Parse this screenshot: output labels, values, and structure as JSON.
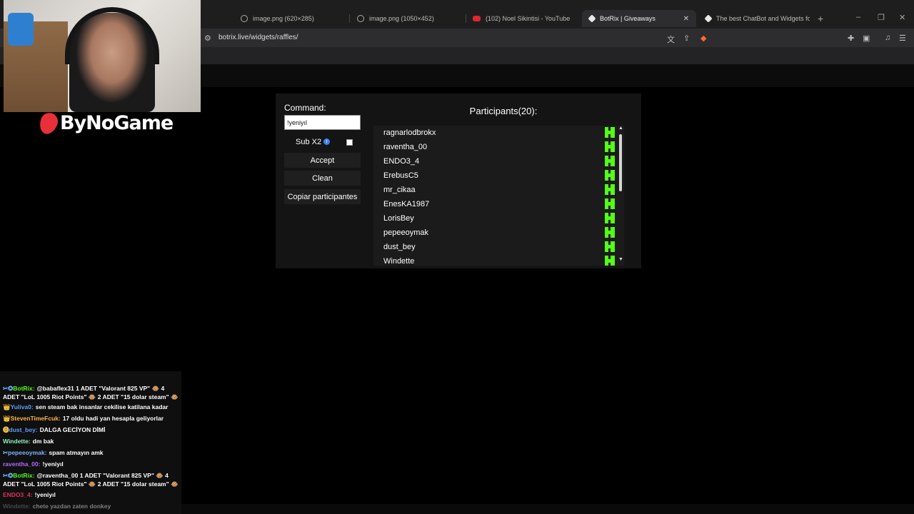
{
  "browser": {
    "tabs": [
      {
        "title": "image.png (620×285)",
        "active": false
      },
      {
        "title": "image.png (1050×452)",
        "active": false
      },
      {
        "title": "(102) Noel Sikintisi - YouTube",
        "active": false
      },
      {
        "title": "BotRix | Giveaways",
        "active": true
      },
      {
        "title": "The best ChatBot and Widgets for K",
        "active": false
      }
    ],
    "new_tab": "+",
    "close_tab": "✕",
    "url": "botrix.live/widgets/raffles/",
    "window_controls": [
      "–",
      "❐",
      "✕"
    ]
  },
  "overlay": {
    "logo_text": "ByNoGame"
  },
  "raffle": {
    "command_label": "Command:",
    "command_value": "!yeniyıl",
    "sub_label": "Sub X2",
    "sub_checked": false,
    "accept_label": "Accept",
    "clean_label": "Clean",
    "copy_label": "Copiar participantes",
    "participants_title": "Participants(20):",
    "participants": [
      "ragnarlodbrokx",
      "raventha_00",
      "ENDO3_4",
      "ErebusC5",
      "mr_cikaa",
      "EnesKA1987",
      "LorisBey",
      "pepeeoymak",
      "dust_bey",
      "Windette"
    ],
    "platform_icon": "kick-icon",
    "accent_color": "#53fc18"
  },
  "chat": {
    "messages": [
      {
        "user": "BotRix:",
        "color": "#53fc18",
        "badge": "✂✪",
        "text": "@babaflex31 1 ADET \"Valorant 825 VP\" 🐵 4 ADET \"LoL 1005 Riot Points\" 🐵 2 ADET \"15 dolar steam\" 🐵"
      },
      {
        "user": "Yuliva0:",
        "color": "#5c9dff",
        "badge": "👑",
        "text": "sen steam bak insanlar cekilise katilana kadar"
      },
      {
        "user": "StevenTimeFcuk:",
        "color": "#ffb347",
        "badge": "👑",
        "text": "17 oldu hadi yan hesapla geliyorlar"
      },
      {
        "user": "dust_bey:",
        "color": "#5c9dff",
        "badge": "⓿",
        "text": "DALGA GECİYON DİMİ"
      },
      {
        "user": "Windette:",
        "color": "#8ef0c0",
        "badge": "",
        "text": "dm bak"
      },
      {
        "user": "pepeeoymak:",
        "color": "#7fb2ff",
        "badge": "✂",
        "text": "spam atmayın amk"
      },
      {
        "user": "raventha_00:",
        "color": "#b26bff",
        "badge": "",
        "text": "!yeniyıl"
      },
      {
        "user": "BotRix:",
        "color": "#53fc18",
        "badge": "✂✪",
        "text": "@raventha_00 1 ADET \"Valorant 825 VP\" 🐵 4 ADET \"LoL 1005 Riot Points\" 🐵 2 ADET \"15 dolar steam\" 🐵"
      },
      {
        "user": "ENDO3_4:",
        "color": "#e03058",
        "badge": "",
        "text": "!yeniyıl"
      },
      {
        "user": "Windette:",
        "color": "#8a8a8a",
        "badge": "",
        "text": "chete yazdan zaten donkey"
      }
    ]
  }
}
